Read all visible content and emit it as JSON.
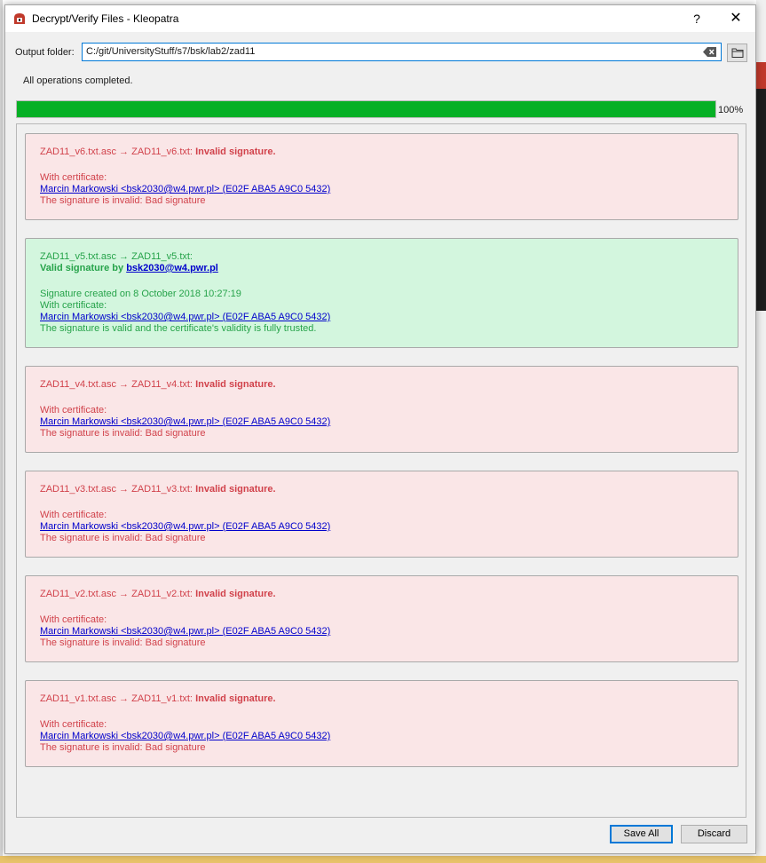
{
  "window": {
    "title": "Decrypt/Verify Files - Kleopatra",
    "help_label": "?",
    "close_label": "✕"
  },
  "output": {
    "label": "Output folder:",
    "value": "C:/git/UniversityStuff/s7/bsk/lab2/zad11"
  },
  "status_text": "All operations completed.",
  "progress": {
    "value": 100,
    "label": "100%"
  },
  "colors": {
    "progress": "#06b025",
    "invalid_bg": "#fae6e7",
    "invalid_text": "#d1424b",
    "valid_bg": "#d3f6de",
    "valid_text": "#26a34a",
    "link": "#0000cc"
  },
  "results": [
    {
      "status": "invalid",
      "files": "ZAD11_v6.txt.asc → ZAD11_v6.txt:",
      "headline": "Invalid signature.",
      "with_cert": "With certificate:",
      "cert_link": "Marcin Markowski <bsk2030@w4.pwr.pl> (E02F ABA5 A9C0 5432)",
      "detail": "The signature is invalid: Bad signature"
    },
    {
      "status": "valid",
      "files": "ZAD11_v5.txt.asc → ZAD11_v5.txt:",
      "headline_prefix": "Valid signature by",
      "headline_link": "bsk2030@w4.pwr.pl",
      "created": "Signature created on 8 October 2018 10:27:19",
      "with_cert": "With certificate:",
      "cert_link": "Marcin Markowski <bsk2030@w4.pwr.pl> (E02F ABA5 A9C0 5432)",
      "detail": "The signature is valid and the certificate's validity is fully trusted."
    },
    {
      "status": "invalid",
      "files": "ZAD11_v4.txt.asc → ZAD11_v4.txt:",
      "headline": "Invalid signature.",
      "with_cert": "With certificate:",
      "cert_link": "Marcin Markowski <bsk2030@w4.pwr.pl> (E02F ABA5 A9C0 5432)",
      "detail": "The signature is invalid: Bad signature"
    },
    {
      "status": "invalid",
      "files": "ZAD11_v3.txt.asc → ZAD11_v3.txt:",
      "headline": "Invalid signature.",
      "with_cert": "With certificate:",
      "cert_link": "Marcin Markowski <bsk2030@w4.pwr.pl> (E02F ABA5 A9C0 5432)",
      "detail": "The signature is invalid: Bad signature"
    },
    {
      "status": "invalid",
      "files": "ZAD11_v2.txt.asc → ZAD11_v2.txt:",
      "headline": "Invalid signature.",
      "with_cert": "With certificate:",
      "cert_link": "Marcin Markowski <bsk2030@w4.pwr.pl> (E02F ABA5 A9C0 5432)",
      "detail": "The signature is invalid: Bad signature"
    },
    {
      "status": "invalid",
      "files": "ZAD11_v1.txt.asc → ZAD11_v1.txt:",
      "headline": "Invalid signature.",
      "with_cert": "With certificate:",
      "cert_link": "Marcin Markowski <bsk2030@w4.pwr.pl> (E02F ABA5 A9C0 5432)",
      "detail": "The signature is invalid: Bad signature"
    }
  ],
  "buttons": {
    "save_all": "Save All",
    "discard": "Discard"
  }
}
